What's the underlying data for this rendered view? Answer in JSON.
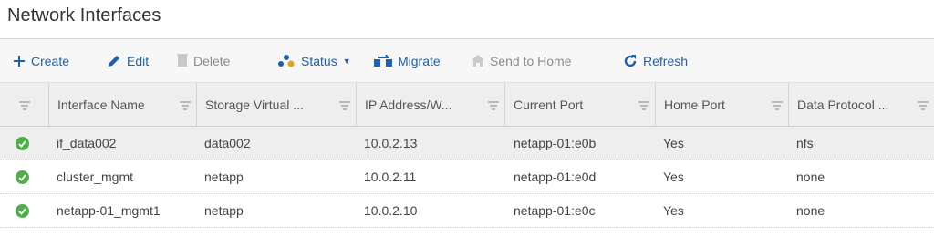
{
  "page": {
    "title": "Network Interfaces"
  },
  "colors": {
    "accent": "#1e5fb0",
    "disabled": "#8b8b8b",
    "status_ok": "#4fae4a"
  },
  "toolbar": {
    "create": {
      "label": "Create",
      "icon": "plus-icon"
    },
    "edit": {
      "label": "Edit",
      "icon": "pencil-icon"
    },
    "delete": {
      "label": "Delete",
      "icon": "trash-icon"
    },
    "status": {
      "label": "Status",
      "icon": "cluster-icon"
    },
    "migrate": {
      "label": "Migrate",
      "icon": "migrate-icon"
    },
    "send_home": {
      "label": "Send to Home",
      "icon": "home-icon"
    },
    "refresh": {
      "label": "Refresh",
      "icon": "refresh-icon"
    }
  },
  "table": {
    "columns": [
      "",
      "Interface Name",
      "Storage Virtual ...",
      "IP Address/W...",
      "Current Port",
      "Home Port",
      "Data Protocol ..."
    ],
    "rows": [
      {
        "status": "ok",
        "name": "if_data002",
        "svm": "data002",
        "ip": "10.0.2.13",
        "current_port": "netapp-01:e0b",
        "home_port": "Yes",
        "protocol": "nfs",
        "selected": true
      },
      {
        "status": "ok",
        "name": "cluster_mgmt",
        "svm": "netapp",
        "ip": "10.0.2.11",
        "current_port": "netapp-01:e0d",
        "home_port": "Yes",
        "protocol": "none",
        "selected": false
      },
      {
        "status": "ok",
        "name": "netapp-01_mgmt1",
        "svm": "netapp",
        "ip": "10.0.2.10",
        "current_port": "netapp-01:e0c",
        "home_port": "Yes",
        "protocol": "none",
        "selected": false
      }
    ]
  }
}
